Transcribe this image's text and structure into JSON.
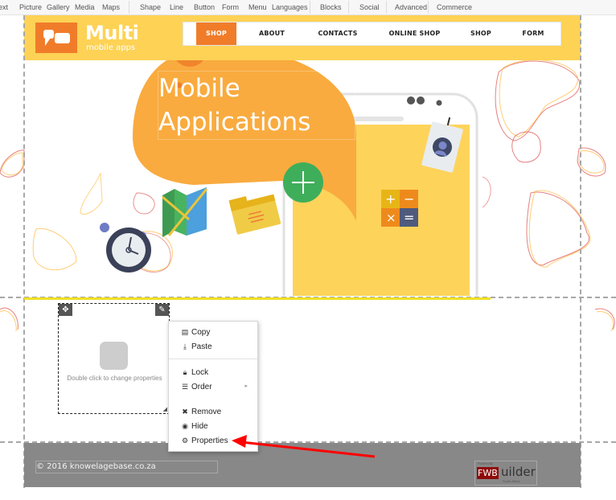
{
  "toolbar": {
    "items": [
      "ext",
      "Picture",
      "Gallery",
      "Media",
      "Maps",
      "Shape",
      "Line",
      "Button",
      "Form",
      "Menu",
      "Languages",
      "Blocks",
      "Social",
      "Advanced",
      "Commerce"
    ]
  },
  "header": {
    "logo_title": "Multi",
    "logo_subtitle": "mobile apps",
    "nav": [
      {
        "label": "SHOP",
        "active": true
      },
      {
        "label": "ABOUT",
        "active": false
      },
      {
        "label": "CONTACTS",
        "active": false
      },
      {
        "label": "ONLINE SHOP",
        "active": false
      },
      {
        "label": "SHOP",
        "active": false
      },
      {
        "label": "FORM",
        "active": false
      }
    ]
  },
  "hero": {
    "title": "Mobile\nApplications"
  },
  "widget": {
    "placeholder_text": "Double click to change properties",
    "move_icon": "move-arrows-icon",
    "edit_icon": "pencil-icon"
  },
  "context_menu": {
    "items": [
      {
        "label": "Copy",
        "icon": "copy-icon"
      },
      {
        "label": "Paste",
        "icon": "download-icon"
      },
      {
        "label": "Lock",
        "icon": "lock-icon"
      },
      {
        "label": "Order",
        "icon": "list-icon",
        "submenu": true
      },
      {
        "label": "Remove",
        "icon": "x-icon"
      },
      {
        "label": "Hide",
        "icon": "eye-icon"
      },
      {
        "label": "Properties",
        "icon": "gear-icon"
      }
    ]
  },
  "footer": {
    "copyright": "© 2016 knowelagebase.co.za",
    "badge_powered": "Powered By",
    "badge_red": "FWB",
    "badge_rest": "uilder",
    "badge_region": "South Africa"
  },
  "colors": {
    "brand_orange": "#f07c2a",
    "header_yellow": "#fdd255",
    "bubble_orange": "#f9ab3f",
    "footer_gray": "#888888",
    "annotation_red": "#ff0000",
    "plus_green": "#3fae5a"
  }
}
